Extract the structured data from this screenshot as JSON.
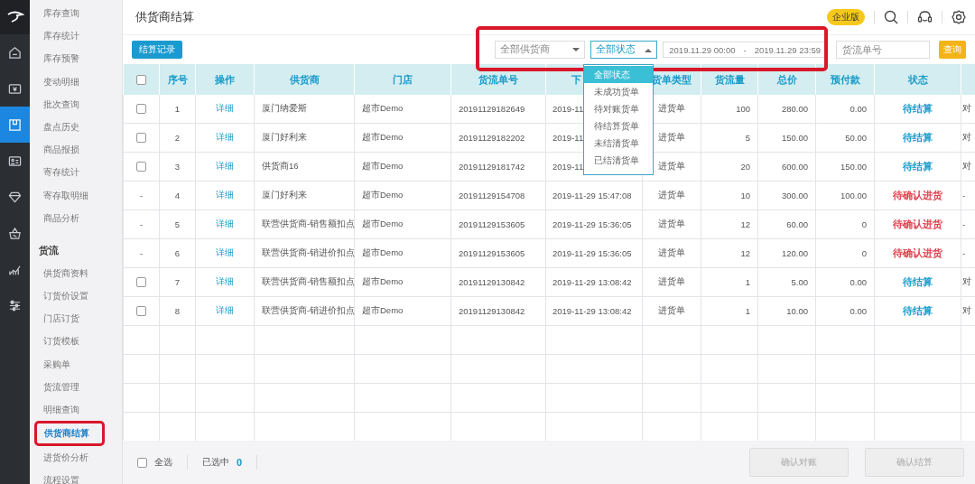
{
  "rail": {
    "items": [
      {
        "kind": "home",
        "selected": false
      },
      {
        "kind": "money",
        "selected": false
      },
      {
        "kind": "box",
        "selected": true
      },
      {
        "kind": "card",
        "selected": false
      },
      {
        "kind": "diamond",
        "selected": false
      },
      {
        "kind": "basket",
        "selected": false
      },
      {
        "kind": "chart",
        "selected": false
      },
      {
        "kind": "sliders",
        "selected": false
      }
    ]
  },
  "sidebar": {
    "groups": [
      {
        "items": [
          {
            "label": "库存查询",
            "selected": false
          },
          {
            "label": "库存统计",
            "selected": false
          },
          {
            "label": "库存预警",
            "selected": false
          },
          {
            "label": "变动明细",
            "selected": false
          },
          {
            "label": "批次查询",
            "selected": false
          },
          {
            "label": "盘点历史",
            "selected": false
          },
          {
            "label": "商品报损",
            "selected": false
          },
          {
            "label": "寄存统计",
            "selected": false
          },
          {
            "label": "寄存取明细",
            "selected": false
          },
          {
            "label": "商品分析",
            "selected": false
          }
        ]
      },
      {
        "title": "货流",
        "items": [
          {
            "label": "供货商资料",
            "selected": false
          },
          {
            "label": "订货价设置",
            "selected": false
          },
          {
            "label": "门店订货",
            "selected": false
          },
          {
            "label": "订货模板",
            "selected": false
          },
          {
            "label": "采购单",
            "selected": false
          },
          {
            "label": "货流管理",
            "selected": false
          },
          {
            "label": "明细查询",
            "selected": false
          },
          {
            "label": "供货商结算",
            "selected": true
          },
          {
            "label": "进货价分析",
            "selected": false
          },
          {
            "label": "流程设置",
            "selected": false
          }
        ]
      }
    ]
  },
  "header": {
    "title": "供货商结算",
    "badge": "企业版"
  },
  "toolbar": {
    "record_button": "结算记录",
    "supplier_select": "全部供货商",
    "status_select": "全部状态",
    "date_from": "2019.11.29 00:00",
    "date_sep": "-",
    "date_to": "2019.11.29 23:59",
    "order_placeholder": "货流单号",
    "query_button": "查询"
  },
  "status_dropdown": {
    "options": [
      {
        "label": "全部状态",
        "selected": true
      },
      {
        "label": "未成功货单",
        "selected": false
      },
      {
        "label": "待对账货单",
        "selected": false
      },
      {
        "label": "待结算货单",
        "selected": false
      },
      {
        "label": "未结清货单",
        "selected": false
      },
      {
        "label": "已结清货单",
        "selected": false
      }
    ]
  },
  "table": {
    "header_checkbox": {
      "checked": false
    },
    "columns": [
      "序号",
      "操作",
      "供货商",
      "门店",
      "货流单号",
      "下",
      "货单类型",
      "货流量",
      "总价",
      "预付款",
      "状态"
    ],
    "rows": [
      {
        "select": {
          "kind": "checkbox",
          "checked": false
        },
        "cells": [
          "1",
          "详细",
          "厦门纳爱斯",
          "超市Demo",
          "20191129182649",
          "2019-11",
          "进货单",
          "100",
          "280.00",
          "0.00"
        ],
        "status": {
          "text": "待结算",
          "color": "#1a9bc8"
        },
        "column_13": "对"
      },
      {
        "select": {
          "kind": "checkbox",
          "checked": false
        },
        "cells": [
          "2",
          "详细",
          "厦门好利来",
          "超市Demo",
          "20191129182202",
          "2019-11",
          "进货单",
          "5",
          "150.00",
          "50.00"
        ],
        "status": {
          "text": "待结算",
          "color": "#1a9bc8"
        },
        "column_13": "对"
      },
      {
        "select": {
          "kind": "checkbox",
          "checked": false
        },
        "cells": [
          "3",
          "详细",
          "供货商16",
          "超市Demo",
          "20191129181742",
          "2019-11",
          "进货单",
          "20",
          "600.00",
          "150.00"
        ],
        "status": {
          "text": "待结算",
          "color": "#1a9bc8"
        },
        "column_13": "对"
      },
      {
        "select": {
          "kind": "text",
          "text": "-"
        },
        "cells": [
          "4",
          "详细",
          "厦门好利来",
          "超市Demo",
          "20191129154708",
          "2019-11-29 15:47:08",
          "进货单",
          "10",
          "300.00",
          "100.00"
        ],
        "status": {
          "text": "待确认进货",
          "color": "#e0404d"
        },
        "column_13": "-"
      },
      {
        "select": {
          "kind": "text",
          "text": "-"
        },
        "cells": [
          "5",
          "详细",
          "联营供货商-销售额扣点",
          "超市Demo",
          "20191129153605",
          "2019-11-29 15:36:05",
          "进货单",
          "12",
          "60.00",
          "0"
        ],
        "status": {
          "text": "待确认进货",
          "color": "#e0404d"
        },
        "column_13": "-"
      },
      {
        "select": {
          "kind": "text",
          "text": "-"
        },
        "cells": [
          "6",
          "详细",
          "联营供货商-销进价扣点",
          "超市Demo",
          "20191129153605",
          "2019-11-29 15:36:05",
          "进货单",
          "12",
          "120.00",
          "0"
        ],
        "status": {
          "text": "待确认进货",
          "color": "#e0404d"
        },
        "column_13": "-"
      },
      {
        "select": {
          "kind": "checkbox",
          "checked": false
        },
        "cells": [
          "7",
          "详细",
          "联营供货商-销售额扣点",
          "超市Demo",
          "20191129130842",
          "2019-11-29 13:08:42",
          "进货单",
          "1",
          "5.00",
          "0.00"
        ],
        "status": {
          "text": "待结算",
          "color": "#1a9bc8"
        },
        "column_13": "对"
      },
      {
        "select": {
          "kind": "checkbox",
          "checked": false
        },
        "cells": [
          "8",
          "详细",
          "联营供货商-销进价扣点",
          "超市Demo",
          "20191129130842",
          "2019-11-29 13:08:42",
          "进货单",
          "1",
          "10.00",
          "0.00"
        ],
        "status": {
          "text": "待结算",
          "color": "#1a9bc8"
        },
        "column_13": "对"
      }
    ]
  },
  "footer": {
    "select_all": {
      "label": "全选",
      "checked": false
    },
    "selected_label": "已选中",
    "selected_count": "0",
    "buttons": [
      {
        "label": "确认对账",
        "disabled": true
      },
      {
        "label": "确认结算",
        "disabled": true
      }
    ]
  }
}
